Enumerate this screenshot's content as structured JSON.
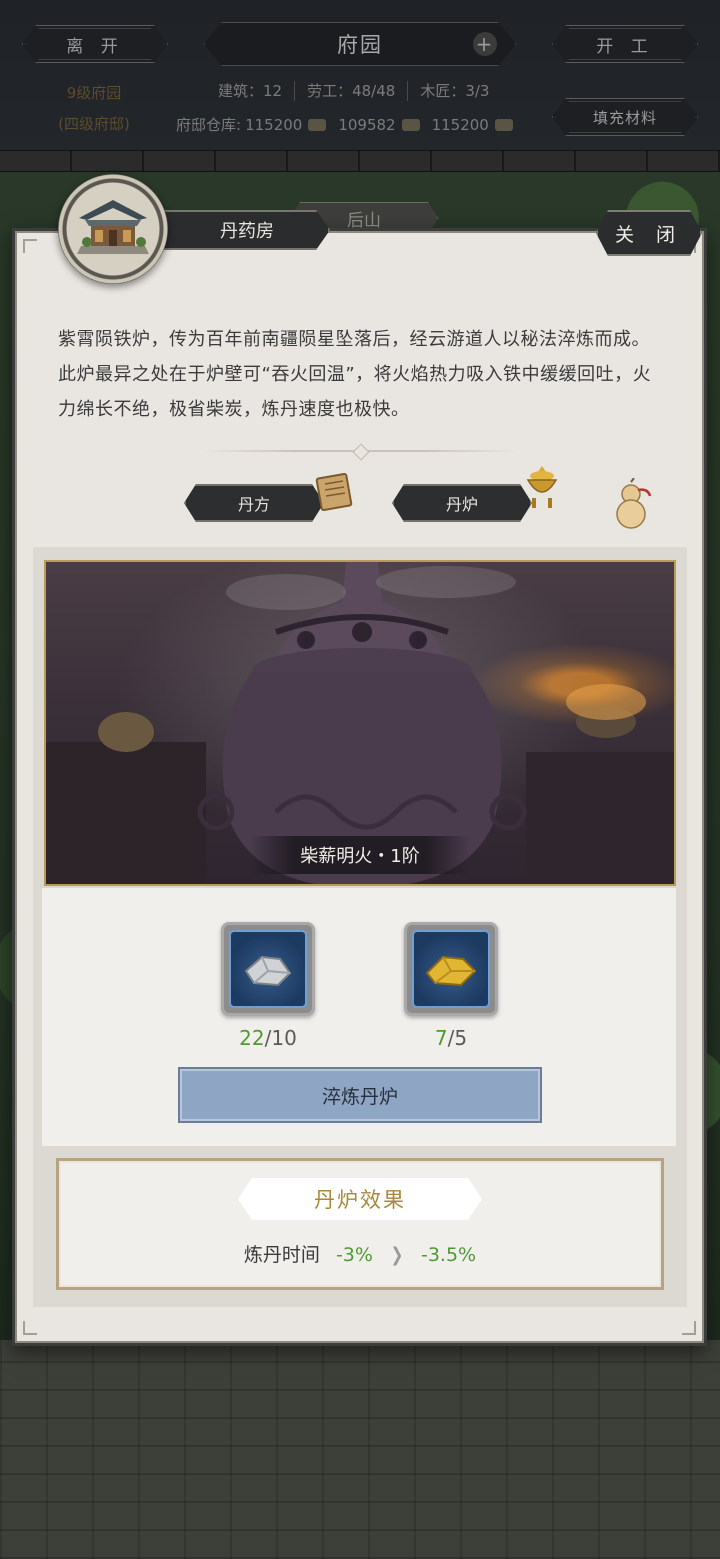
{
  "hud": {
    "leave_label": "离 开",
    "title": "府园",
    "work_label": "开 工",
    "fill_label": "填充材料",
    "garden_level": "9级府园",
    "garden_rank": "(四级府邸)",
    "stats": {
      "buildings": "建筑：12",
      "labor": "劳工：48/48",
      "carpenter": "木匠：3/3"
    },
    "storage": {
      "label": "府邸仓库:",
      "item1": "115200",
      "item2": "109582",
      "item3": "115200"
    }
  },
  "back_tab_label": "后山",
  "panel": {
    "building_name": "丹药房",
    "close_label": "关 闭",
    "description": "紫霄陨铁炉，传为百年前南疆陨星坠落后，经云游道人以秘法淬炼而成。此炉最异之处在于炉壁可“吞火回温”，将火焰热力吸入铁中缓缓回吐，火力绵长不绝，极省柴炭，炼丹速度也极快。",
    "tabs": {
      "recipe_label": "丹方",
      "furnace_label": "丹炉"
    },
    "furnace_caption": "柴薪明火・1阶",
    "materials": [
      {
        "name": "silver-ore",
        "have": "22",
        "need": "/10"
      },
      {
        "name": "gold-ore",
        "have": "7",
        "need": "/5"
      }
    ],
    "refine_label": "淬炼丹炉",
    "effect": {
      "title": "丹炉效果",
      "row_label": "炼丹时间",
      "current": "-3%",
      "next": "-3.5%"
    }
  },
  "colors": {
    "accent_gold": "#a7893a",
    "positive_green": "#4e9a33",
    "button_blue": "#8fa5c4"
  }
}
